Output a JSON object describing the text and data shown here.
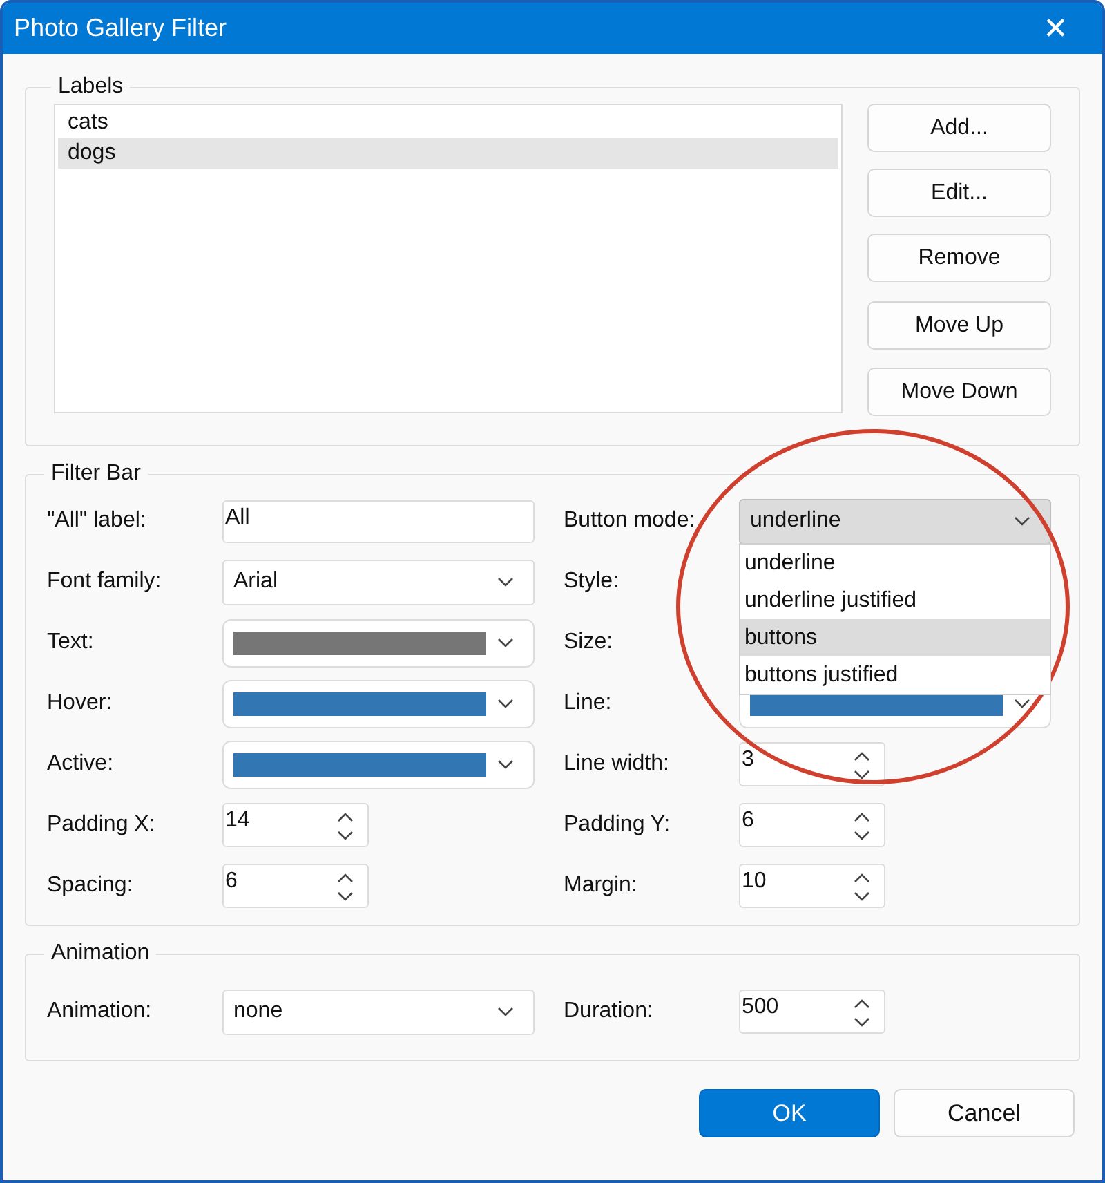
{
  "window": {
    "title": "Photo Gallery Filter",
    "close": "✕"
  },
  "labels_group": {
    "title": "Labels",
    "items": [
      {
        "text": "cats",
        "selected": false
      },
      {
        "text": "dogs",
        "selected": true
      }
    ],
    "buttons": [
      "Add...",
      "Edit...",
      "Remove",
      "Move Up",
      "Move Down"
    ]
  },
  "filter_bar": {
    "title": "Filter Bar",
    "left": [
      {
        "label": "\"All\" label:",
        "kind": "text",
        "value": "All"
      },
      {
        "label": "Font family:",
        "kind": "combo",
        "value": "Arial"
      },
      {
        "label": "Text:",
        "kind": "color",
        "color": "#767676"
      },
      {
        "label": "Hover:",
        "kind": "color",
        "color": "#3277b4"
      },
      {
        "label": "Active:",
        "kind": "color",
        "color": "#3277b4"
      },
      {
        "label": "Padding X:",
        "kind": "spin",
        "value": "14"
      },
      {
        "label": "Spacing:",
        "kind": "spin",
        "value": "6"
      }
    ],
    "right": [
      {
        "label": "Button mode:",
        "kind": "combo",
        "value": "underline",
        "open": true,
        "options": [
          {
            "text": "underline",
            "highlighted": false
          },
          {
            "text": "underline justified",
            "highlighted": false
          },
          {
            "text": "buttons",
            "highlighted": true
          },
          {
            "text": "buttons justified",
            "highlighted": false
          }
        ]
      },
      {
        "label": "Style:",
        "kind": "covered"
      },
      {
        "label": "Size:",
        "kind": "covered"
      },
      {
        "label": "Line:",
        "kind": "color",
        "color": "#3277b4"
      },
      {
        "label": "Line width:",
        "kind": "spin",
        "value": "3"
      },
      {
        "label": "Padding Y:",
        "kind": "spin",
        "value": "6"
      },
      {
        "label": "Margin:",
        "kind": "spin",
        "value": "10"
      }
    ]
  },
  "animation_group": {
    "title": "Animation",
    "left": [
      {
        "label": "Animation:",
        "kind": "combo",
        "value": "none"
      }
    ],
    "right": [
      {
        "label": "Duration:",
        "kind": "spin",
        "value": "500"
      }
    ]
  },
  "buttons": [
    {
      "label": "OK",
      "default": true
    },
    {
      "label": "Cancel",
      "default": false
    }
  ]
}
